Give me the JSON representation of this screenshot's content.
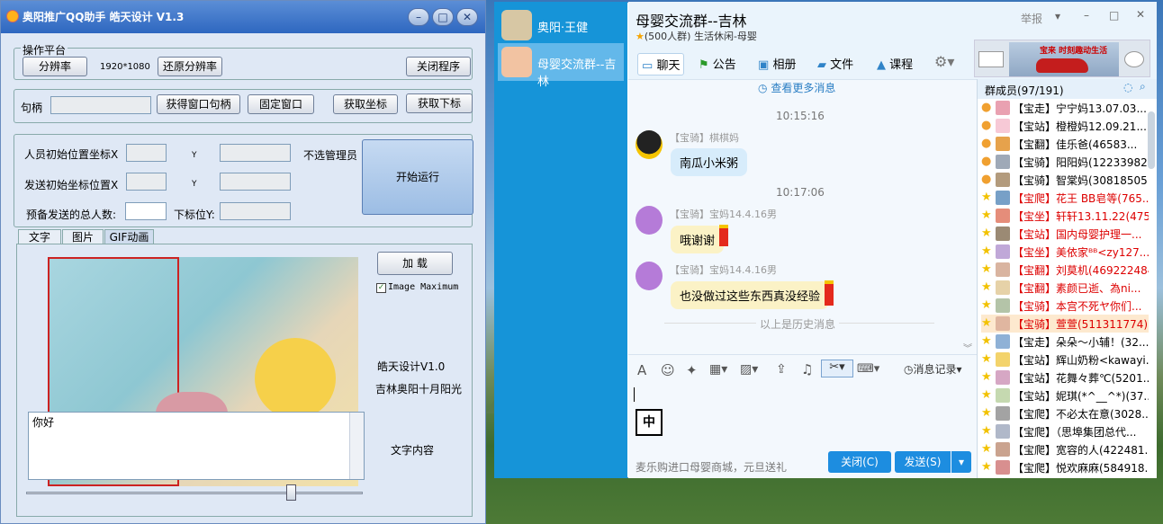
{
  "app": {
    "title": "奥阳推广QQ助手 皓天设计 V1.3",
    "platform_legend": "操作平台",
    "resolution_btn": "分辨率",
    "resolution_value": "1920*1080",
    "restore_btn": "还原分辨率",
    "close_btn": "关闭程序",
    "handle_label": "句柄",
    "get_handle_btn": "获得窗口句柄",
    "fix_window_btn": "固定窗口",
    "get_coord_btn": "获取坐标",
    "get_sub_btn": "获取下标",
    "person_start_x": "人员初始位置坐标X",
    "y_label1": "Y",
    "send_start_x": "发送初始坐标位置X",
    "y_label2": "Y",
    "total_label": "预备发送的总人数:",
    "sub_y_label": "下标位Y:",
    "no_admin": "不选管理员",
    "start_btn": "开始运行",
    "tabs": [
      "文字",
      "图片",
      "GIF动画"
    ],
    "load_btn": "加  载",
    "image_max": "Image Maximum",
    "credit1": "皓天设计V1.0",
    "credit2": "吉林奥阳十月阳光",
    "textarea_value": "你好",
    "text_content_label": "文字内容"
  },
  "qq": {
    "contacts": [
      {
        "name": "奥阳·王健"
      },
      {
        "name": "母婴交流群--吉林"
      }
    ],
    "group_title": "母婴交流群--吉林",
    "group_sub": "(500人群) 生活休闲-母婴",
    "report": "举报",
    "tabs": [
      "聊天",
      "公告",
      "相册",
      "文件",
      "课程"
    ],
    "more_msgs": "查看更多消息",
    "ad_text": "宝来 时刻趣动生活",
    "messages": [
      {
        "time": "10:15:16",
        "sender": "【宝骑】棋棋妈",
        "text": "南瓜小米粥"
      },
      {
        "time": "10:17:06",
        "sender": "【宝骑】宝妈14.4.16男",
        "text": "哦谢谢"
      },
      {
        "time": "",
        "sender": "【宝骑】宝妈14.4.16男",
        "text": "也没做过这些东西真没经验"
      }
    ],
    "history_note": "以上是历史消息",
    "msg_record": "消息记录",
    "ime": "中",
    "footer_promo": "麦乐购进口母婴商城，元旦送礼",
    "close_btn": "关闭(C)",
    "send_btn": "发送(S)",
    "members_title": "群成员(97/191)",
    "members": [
      {
        "name": "【宝走】宁宁妈13.07.03...",
        "color": "#000"
      },
      {
        "name": "【宝站】橙橙妈12.09.21...",
        "color": "#000"
      },
      {
        "name": "【宝翻】佳乐爸(46583...",
        "color": "#000"
      },
      {
        "name": "【宝骑】阳阳妈(12233982...",
        "color": "#000"
      },
      {
        "name": "【宝骑】智棠妈(30818505...",
        "color": "#000"
      },
      {
        "name": "【宝爬】花王 BB皂等(765...",
        "color": "#d00"
      },
      {
        "name": "【宝坐】轩轩13.11.22(475...",
        "color": "#d00"
      },
      {
        "name": "【宝站】国内母婴护理一...",
        "color": "#d00"
      },
      {
        "name": "【宝坐】美依家ᴮᴮ<zy127...",
        "color": "#d00"
      },
      {
        "name": "【宝翻】刘莫机(469222484)",
        "color": "#d00"
      },
      {
        "name": "【宝翻】素颜已逝、為ni...",
        "color": "#d00"
      },
      {
        "name": "【宝骑】本宫不死ヤ你们...",
        "color": "#d00"
      },
      {
        "name": "【宝骑】萱萱(511311774)",
        "color": "#d00"
      },
      {
        "name": "【宝走】朵朵～小辅！(32...",
        "color": "#000"
      },
      {
        "name": "【宝站】辉山奶粉<kawayi...",
        "color": "#000"
      },
      {
        "name": "【宝站】花舞々葬℃(5201...",
        "color": "#000"
      },
      {
        "name": "【宝站】妮琪(*^__^*)(37...",
        "color": "#000"
      },
      {
        "name": "【宝爬】不必太在意(3028...",
        "color": "#000"
      },
      {
        "name": "【宝爬】（思埠集团总代...",
        "color": "#000"
      },
      {
        "name": "【宝爬】宽容的人(422481...",
        "color": "#000"
      },
      {
        "name": "【宝爬】悦欢麻麻(584918...",
        "color": "#000"
      }
    ]
  }
}
